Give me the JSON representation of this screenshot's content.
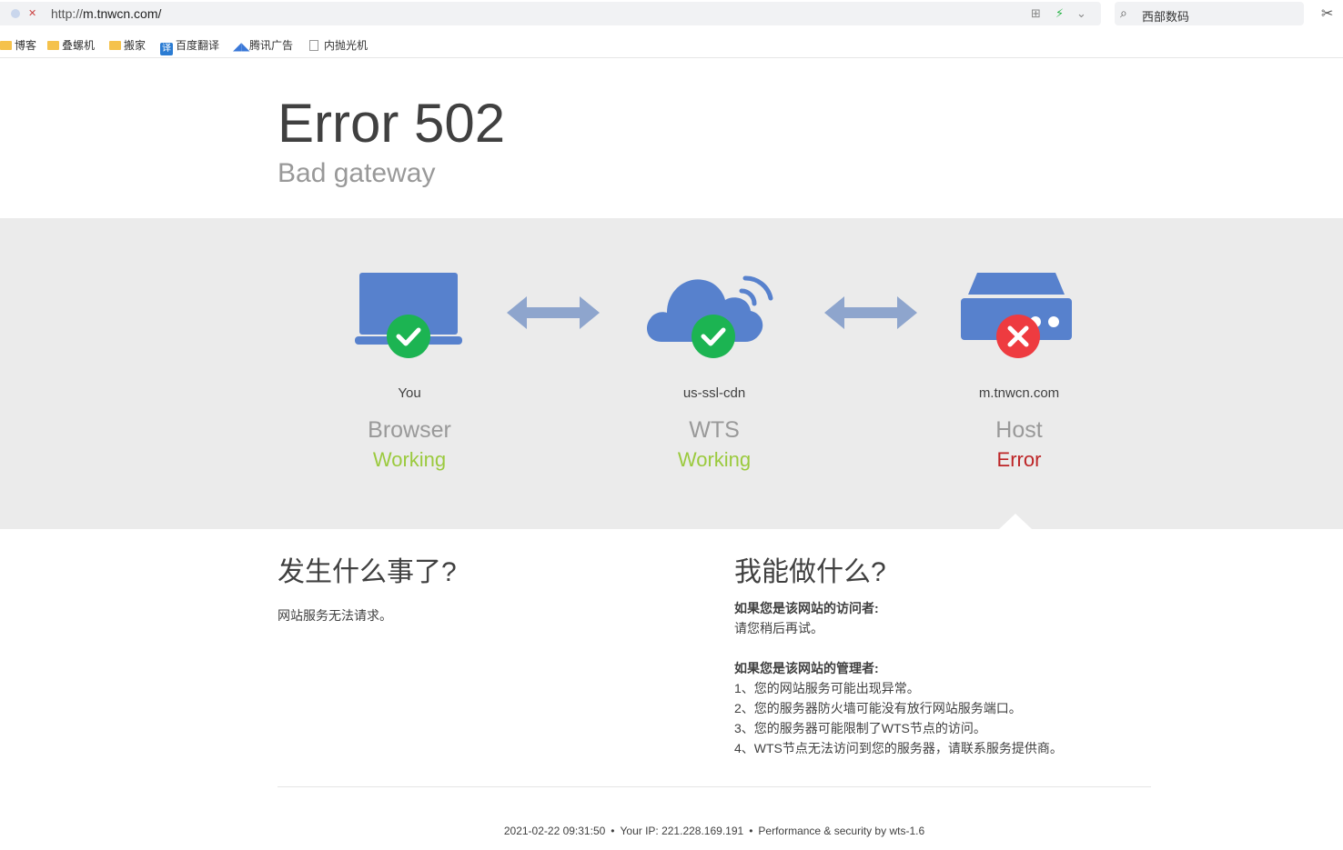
{
  "browser": {
    "url_scheme": "http://",
    "url_host": "m.tnwcn.com/",
    "search_text": "西部数码",
    "bookmarks": [
      {
        "label": "博客",
        "kind": "folder"
      },
      {
        "label": "叠螺机",
        "kind": "folder"
      },
      {
        "label": "搬家",
        "kind": "folder"
      },
      {
        "label": "百度翻译",
        "kind": "translate"
      },
      {
        "label": "腾讯广告",
        "kind": "tencent"
      },
      {
        "label": "内抛光机",
        "kind": "page"
      }
    ]
  },
  "error": {
    "title": "Error 502",
    "subtitle": "Bad gateway"
  },
  "nodes": [
    {
      "label": "You",
      "kind": "Browser",
      "status": "Working",
      "status_color": "#9bca3e"
    },
    {
      "label": "us-ssl-cdn",
      "kind": "WTS",
      "status": "Working",
      "status_color": "#9bca3e"
    },
    {
      "label": "m.tnwcn.com",
      "kind": "Host",
      "status": "Error",
      "status_color": "#bd2426"
    }
  ],
  "colors": {
    "icon_blue": "#5781cd",
    "ok_green": "#1cb452",
    "err_red": "#ee3b40",
    "arrow": "#8ea5cd"
  },
  "what_happened": {
    "heading": "发生什么事了?",
    "text": "网站服务无法请求。"
  },
  "what_can_i_do": {
    "heading": "我能做什么?",
    "visitor_title": "如果您是该网站的访问者:",
    "visitor_text": "请您稍后再试。",
    "admin_title": "如果您是该网站的管理者:",
    "admin_items": [
      "1、您的网站服务可能出现异常。",
      "2、您的服务器防火墙可能没有放行网站服务端口。",
      "3、您的服务器可能限制了WTS节点的访问。",
      "4、WTS节点无法访问到您的服务器，请联系服务提供商。"
    ]
  },
  "footer": {
    "timestamp": "2021-02-22 09:31:50",
    "ip": "Your IP: 221.228.169.191",
    "perf": "Performance & security by wts-1.6"
  }
}
